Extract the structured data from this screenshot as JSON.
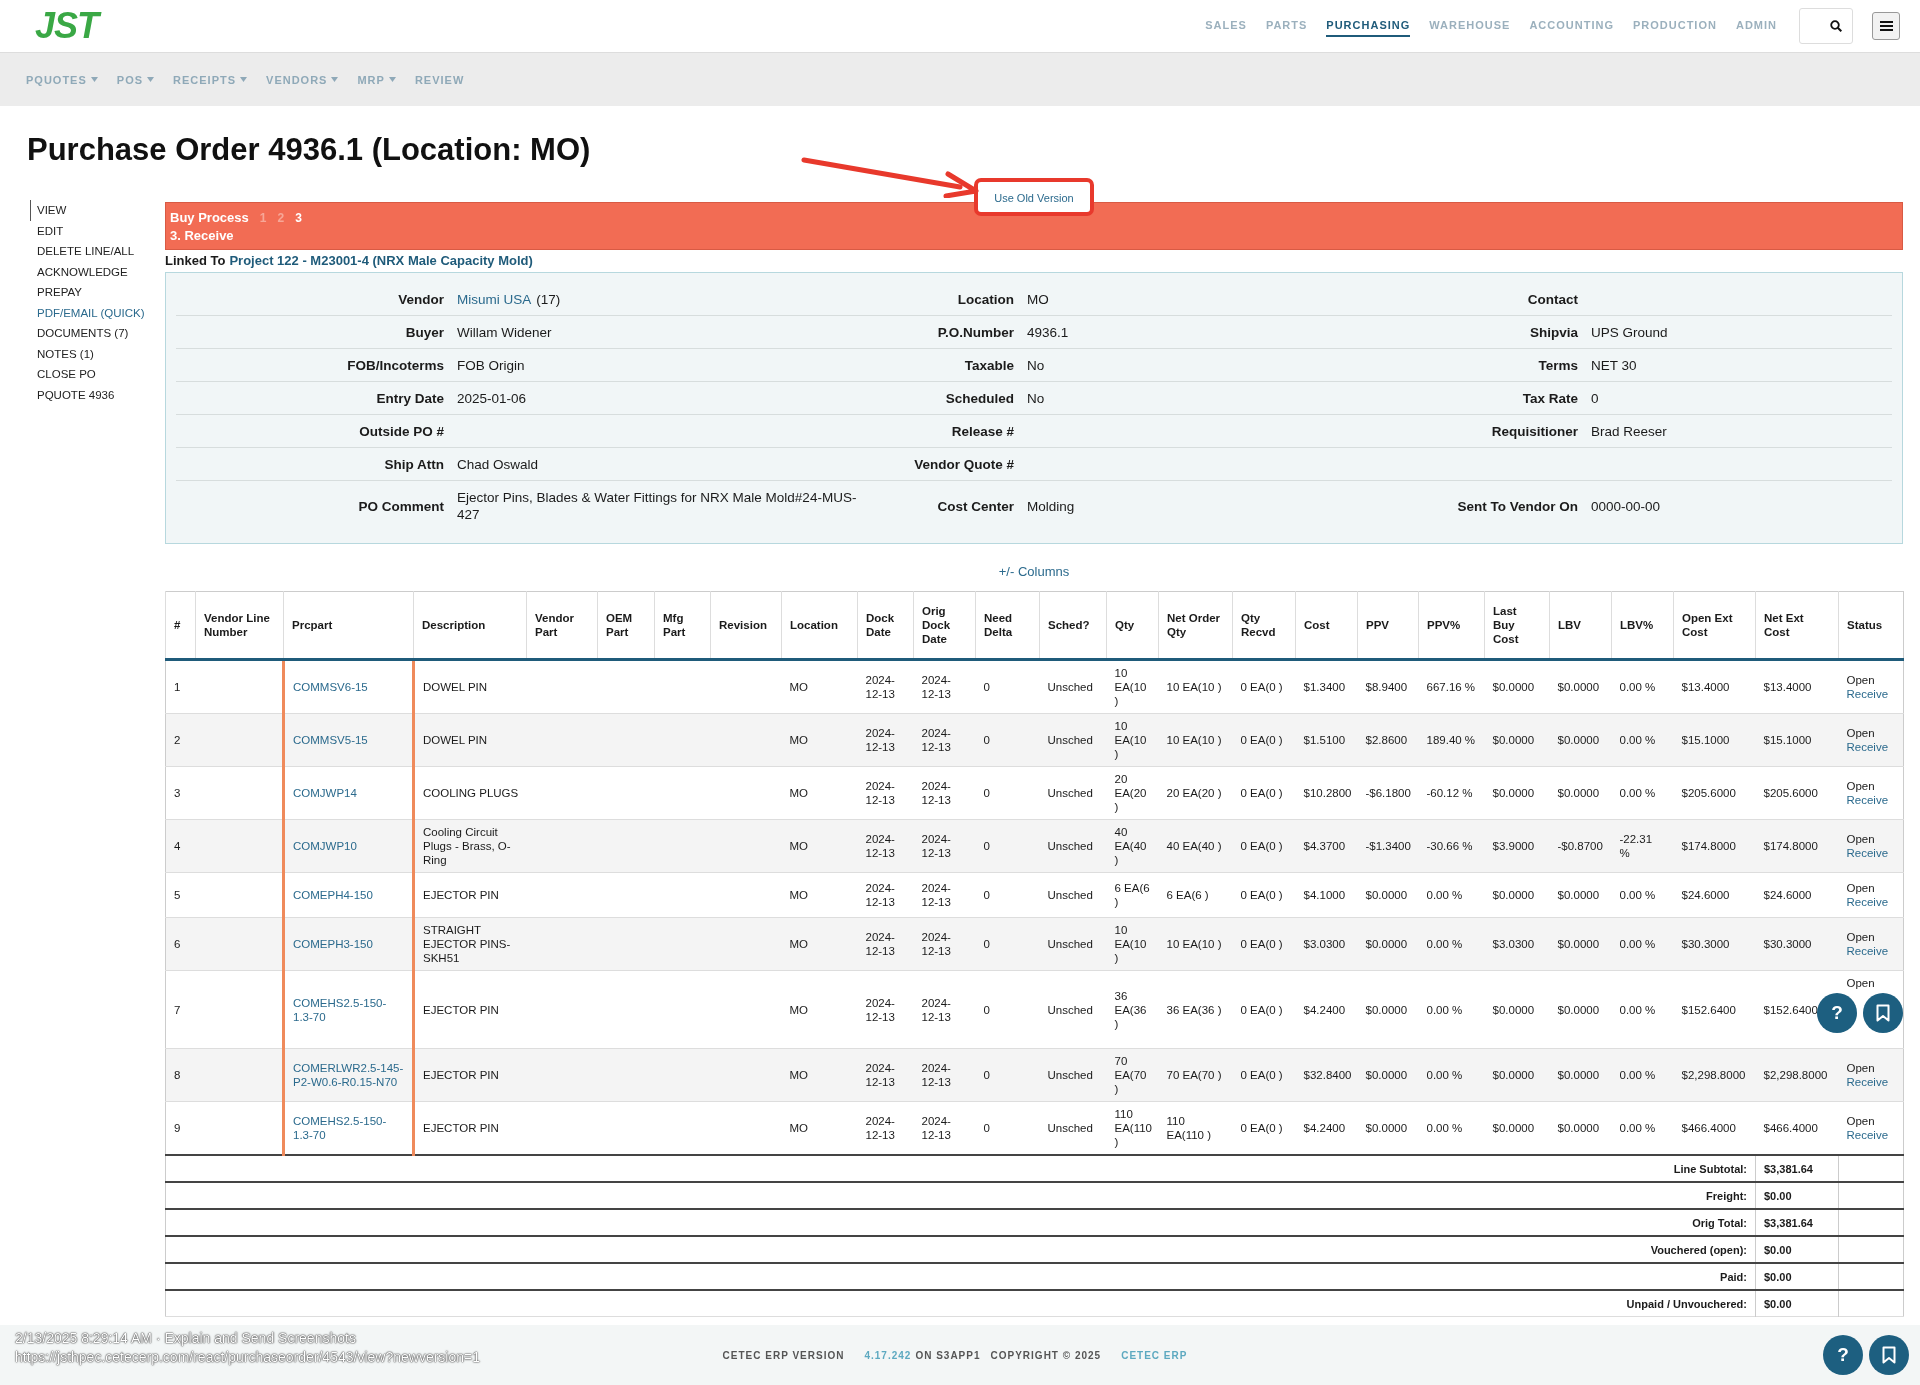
{
  "header": {
    "logo": "JST",
    "nav": [
      {
        "label": "SALES",
        "selected": false
      },
      {
        "label": "PARTS",
        "selected": false
      },
      {
        "label": "PURCHASING",
        "selected": true
      },
      {
        "label": "WAREHOUSE",
        "selected": false
      },
      {
        "label": "ACCOUNTING",
        "selected": false
      },
      {
        "label": "PRODUCTION",
        "selected": false
      },
      {
        "label": "ADMIN",
        "selected": false
      }
    ]
  },
  "subnav": [
    {
      "label": "PQUOTES",
      "dropdown": true
    },
    {
      "label": "POS",
      "dropdown": true
    },
    {
      "label": "RECEIPTS",
      "dropdown": true
    },
    {
      "label": "VENDORS",
      "dropdown": true
    },
    {
      "label": "MRP",
      "dropdown": true
    },
    {
      "label": "REVIEW",
      "dropdown": false
    }
  ],
  "title": "Purchase Order 4936.1 (Location: MO)",
  "sidebar": [
    {
      "label": "VIEW",
      "selected": true,
      "link": false
    },
    {
      "label": "EDIT",
      "selected": false,
      "link": false
    },
    {
      "label": "DELETE LINE/ALL",
      "selected": false,
      "link": false
    },
    {
      "label": "ACKNOWLEDGE",
      "selected": false,
      "link": false
    },
    {
      "label": "PREPAY",
      "selected": false,
      "link": false
    },
    {
      "label": "PDF/EMAIL (QUICK)",
      "selected": false,
      "link": true
    },
    {
      "label": "DOCUMENTS (7)",
      "selected": false,
      "link": false
    },
    {
      "label": "NOTES (1)",
      "selected": false,
      "link": false
    },
    {
      "label": "CLOSE PO",
      "selected": false,
      "link": false
    },
    {
      "label": "PQUOTE 4936",
      "selected": false,
      "link": false
    }
  ],
  "old_version_button": "Use Old Version",
  "process": {
    "title": "Buy Process",
    "steps": [
      {
        "label": "1",
        "selected": false
      },
      {
        "label": "2",
        "selected": false
      },
      {
        "label": "3",
        "selected": true
      }
    ],
    "current": "3. Receive"
  },
  "linked": {
    "label": "Linked To",
    "link": "Project 122 - M23001-4 (NRX Male Capacity Mold)"
  },
  "info": [
    [
      {
        "label": "Vendor",
        "link": "Misumi USA",
        "value": "(17)"
      },
      {
        "label": "Location",
        "value": "MO"
      },
      {
        "label": "Contact"
      }
    ],
    [
      {
        "label": "Buyer",
        "value": "Willam Widener"
      },
      {
        "label": "P.O.Number",
        "value": "4936.1"
      },
      {
        "label": "Shipvia",
        "value": "UPS Ground"
      }
    ],
    [
      {
        "label": "FOB/Incoterms",
        "value": "FOB Origin"
      },
      {
        "label": "Taxable",
        "value": "No"
      },
      {
        "label": "Terms",
        "value": "NET 30"
      }
    ],
    [
      {
        "label": "Entry Date",
        "value": "2025-01-06"
      },
      {
        "label": "Scheduled",
        "value": "No"
      },
      {
        "label": "Tax Rate",
        "value": "0"
      }
    ],
    [
      {
        "label": "Outside PO #"
      },
      {
        "label": "Release #"
      },
      {
        "label": "Requisitioner",
        "value": "Brad Reeser"
      }
    ],
    [
      {
        "label": "Ship Attn",
        "value": "Chad Oswald"
      },
      {
        "label": "Vendor Quote #"
      }
    ],
    [
      {
        "label": "PO Comment",
        "value": "Ejector Pins, Blades & Water Fittings for NRX Male Mold#24-MUS-427"
      },
      {
        "label": "Cost Center",
        "value": "Molding"
      },
      {
        "label": "Sent To Vendor On",
        "value": "0000-00-00"
      }
    ]
  ],
  "columns_toggle": "+/- Columns",
  "table": {
    "columns": [
      {
        "label": "#",
        "kind": "text"
      },
      {
        "label": "Vendor Line Number",
        "kind": "text"
      },
      {
        "label": "Prcpart",
        "kind": "link"
      },
      {
        "label": "Description",
        "kind": "text"
      },
      {
        "label": "Vendor Part",
        "kind": "text"
      },
      {
        "label": "OEM Part",
        "kind": "text"
      },
      {
        "label": "Mfg Part",
        "kind": "text"
      },
      {
        "label": "Revision",
        "kind": "text"
      },
      {
        "label": "Location",
        "kind": "text"
      },
      {
        "label": "Dock Date",
        "kind": "text"
      },
      {
        "label": "Orig Dock Date",
        "kind": "text"
      },
      {
        "label": "Need Delta",
        "kind": "text"
      },
      {
        "label": "Sched?",
        "kind": "text"
      },
      {
        "label": "Qty",
        "kind": "text"
      },
      {
        "label": "Net Order Qty",
        "kind": "text"
      },
      {
        "label": "Qty Recvd",
        "kind": "text"
      },
      {
        "label": "Cost",
        "kind": "text"
      },
      {
        "label": "PPV",
        "kind": "text"
      },
      {
        "label": "PPV%",
        "kind": "text"
      },
      {
        "label": "Last Buy Cost",
        "kind": "text"
      },
      {
        "label": "LBV",
        "kind": "text"
      },
      {
        "label": "LBV%",
        "kind": "text"
      },
      {
        "label": "Open Ext Cost",
        "kind": "text"
      },
      {
        "label": "Net Ext Cost",
        "kind": "text"
      },
      {
        "label": "Status",
        "kind": "status"
      }
    ],
    "rows": [
      {
        "cells": [
          "1",
          null,
          "COMMSV6-15",
          "DOWEL PIN",
          null,
          null,
          null,
          null,
          "MO",
          "2024-12-13",
          "2024-12-13",
          "0",
          "Unsched",
          "10 EA(10 )",
          "10 EA(10 )",
          "0 EA(0 )",
          "$1.3400",
          "$8.9400",
          "667.16 %",
          "$0.0000",
          "$0.0000",
          "0.00 %",
          "$13.4000",
          "$13.4000"
        ],
        "status": "Open",
        "action": "Receive"
      },
      {
        "cells": [
          "2",
          null,
          "COMMSV5-15",
          "DOWEL PIN",
          null,
          null,
          null,
          null,
          "MO",
          "2024-12-13",
          "2024-12-13",
          "0",
          "Unsched",
          "10 EA(10 )",
          "10 EA(10 )",
          "0 EA(0 )",
          "$1.5100",
          "$2.8600",
          "189.40 %",
          "$0.0000",
          "$0.0000",
          "0.00 %",
          "$15.1000",
          "$15.1000"
        ],
        "status": "Open",
        "action": "Receive"
      },
      {
        "cells": [
          "3",
          null,
          "COMJWP14",
          "COOLING PLUGS",
          null,
          null,
          null,
          null,
          "MO",
          "2024-12-13",
          "2024-12-13",
          "0",
          "Unsched",
          "20 EA(20 )",
          "20 EA(20 )",
          "0 EA(0 )",
          "$10.2800",
          "-$6.1800",
          "-60.12 %",
          "$0.0000",
          "$0.0000",
          "0.00 %",
          "$205.6000",
          "$205.6000"
        ],
        "status": "Open",
        "action": "Receive"
      },
      {
        "cells": [
          "4",
          null,
          "COMJWP10",
          "Cooling Circuit Plugs - Brass, O-Ring",
          null,
          null,
          null,
          null,
          "MO",
          "2024-12-13",
          "2024-12-13",
          "0",
          "Unsched",
          "40 EA(40 )",
          "40 EA(40 )",
          "0 EA(0 )",
          "$4.3700",
          "-$1.3400",
          "-30.66 %",
          "$3.9000",
          "-$0.8700",
          "-22.31 %",
          "$174.8000",
          "$174.8000"
        ],
        "status": "Open",
        "action": "Receive"
      },
      {
        "cells": [
          "5",
          null,
          "COMEPH4-150",
          "EJECTOR PIN",
          null,
          null,
          null,
          null,
          "MO",
          "2024-12-13",
          "2024-12-13",
          "0",
          "Unsched",
          "6 EA(6 )",
          "6 EA(6 )",
          "0 EA(0 )",
          "$4.1000",
          "$0.0000",
          "0.00 %",
          "$0.0000",
          "$0.0000",
          "0.00 %",
          "$24.6000",
          "$24.6000"
        ],
        "status": "Open",
        "action": "Receive"
      },
      {
        "cells": [
          "6",
          null,
          "COMEPH3-150",
          "STRAIGHT EJECTOR PINS-SKH51",
          null,
          null,
          null,
          null,
          "MO",
          "2024-12-13",
          "2024-12-13",
          "0",
          "Unsched",
          "10 EA(10 )",
          "10 EA(10 )",
          "0 EA(0 )",
          "$3.0300",
          "$0.0000",
          "0.00 %",
          "$3.0300",
          "$0.0000",
          "0.00 %",
          "$30.3000",
          "$30.3000"
        ],
        "status": "Open",
        "action": "Receive"
      },
      {
        "cells": [
          "7",
          null,
          "COMEHS2.5-150-1.3-70",
          "EJECTOR PIN",
          null,
          null,
          null,
          null,
          "MO",
          "2024-12-13",
          "2024-12-13",
          "0",
          "Unsched",
          "36 EA(36 )",
          "36 EA(36 )",
          "0 EA(0 )",
          "$4.2400",
          "$0.0000",
          "0.00 %",
          "$0.0000",
          "$0.0000",
          "0.00 %",
          "$152.6400",
          "$152.6400"
        ],
        "status": "Open"
      },
      {
        "cells": [
          "8",
          null,
          "COMERLWR2.5-145-P2-W0.6-R0.15-N70",
          "EJECTOR PIN",
          null,
          null,
          null,
          null,
          "MO",
          "2024-12-13",
          "2024-12-13",
          "0",
          "Unsched",
          "70 EA(70 )",
          "70 EA(70 )",
          "0 EA(0 )",
          "$32.8400",
          "$0.0000",
          "0.00 %",
          "$0.0000",
          "$0.0000",
          "0.00 %",
          "$2,298.8000",
          "$2,298.8000"
        ],
        "status": "Open",
        "action": "Receive"
      },
      {
        "cells": [
          "9",
          null,
          "COMEHS2.5-150-1.3-70",
          "EJECTOR PIN",
          null,
          null,
          null,
          null,
          "MO",
          "2024-12-13",
          "2024-12-13",
          "0",
          "Unsched",
          "110 EA(110 )",
          "110 EA(110 )",
          "0 EA(0 )",
          "$4.2400",
          "$0.0000",
          "0.00 %",
          "$0.0000",
          "$0.0000",
          "0.00 %",
          "$466.4000",
          "$466.4000"
        ],
        "status": "Open",
        "action": "Receive"
      }
    ],
    "totals": [
      {
        "label": "Line Subtotal:",
        "value": "$3,381.64"
      },
      {
        "label": "Freight:",
        "value": "$0.00"
      },
      {
        "label": "Orig Total:",
        "value": "$3,381.64"
      },
      {
        "label": "Vouchered (open):",
        "value": "$0.00"
      },
      {
        "label": "Paid:",
        "value": "$0.00"
      },
      {
        "label": "Unpaid / Unvouchered:",
        "value": "$0.00"
      }
    ]
  },
  "floating_help": "?",
  "footer": {
    "version_label": "CETEC ERP VERSION",
    "version": "4.17.242",
    "server": "ON S3APP1",
    "copyright": "COPYRIGHT © 2025",
    "brand": "CETEC ERP",
    "help": "?"
  },
  "capture_stamp": [
    "2/13/2025 8:29:14 AM · Explain and Send Screenshots",
    "https://jsthpec.cetecerp.com/react/purchaseorder/4543/view?newversion=1"
  ]
}
